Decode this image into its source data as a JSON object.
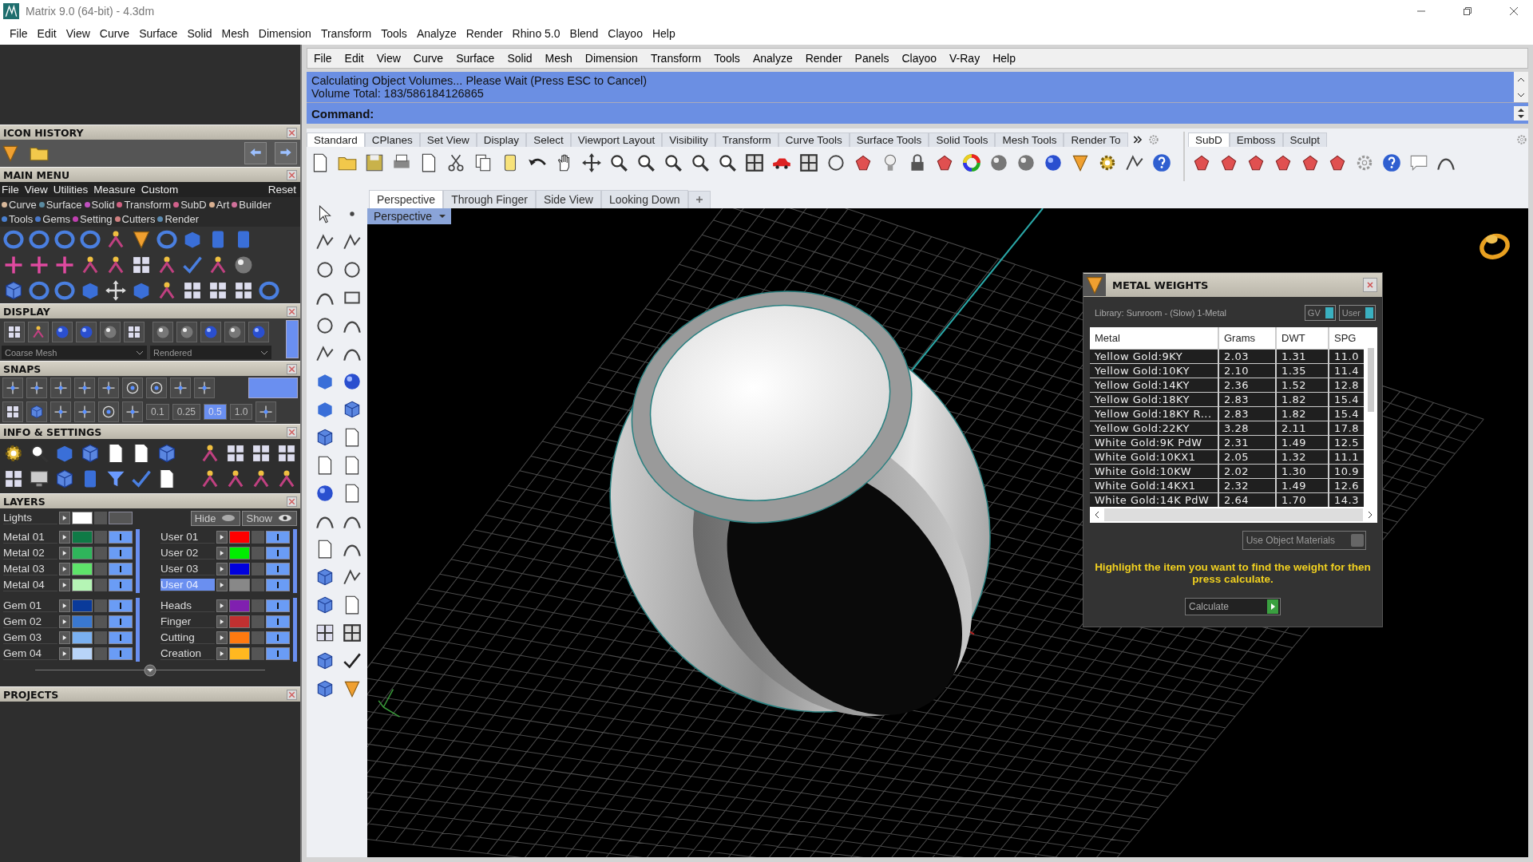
{
  "window": {
    "title": "Matrix 9.0 (64-bit) - 4.3dm"
  },
  "menu_bar": [
    "File",
    "Edit",
    "View",
    "Curve",
    "Surface",
    "Solid",
    "Mesh",
    "Dimension",
    "Transform",
    "Tools",
    "Analyze",
    "Render",
    "Rhino 5.0",
    "Blend",
    "Clayoo",
    "Help"
  ],
  "left_panel": {
    "icon_history": {
      "title": "ICON HISTORY"
    },
    "main_menu": {
      "title": "MAIN MENU",
      "menu": [
        "File",
        "View",
        "Utilities",
        "Measure",
        "Custom"
      ],
      "reset": "Reset",
      "categories": [
        {
          "label": "Curve",
          "color": "#d9b99b"
        },
        {
          "label": "Surface",
          "color": "#5a8aa0"
        },
        {
          "label": "Solid",
          "color": "#c050c0"
        },
        {
          "label": "Transform",
          "color": "#d06080"
        },
        {
          "label": "SubD",
          "color": "#d0608a"
        },
        {
          "label": "Art",
          "color": "#d9b090"
        },
        {
          "label": "Builder",
          "color": "#d0709a"
        },
        {
          "label": "Tools",
          "color": "#4a80d0"
        },
        {
          "label": "Gems",
          "color": "#4a78c8"
        },
        {
          "label": "Setting",
          "color": "#c040b0"
        },
        {
          "label": "Cutters",
          "color": "#d08080"
        },
        {
          "label": "Render",
          "color": "#5a8ab0"
        }
      ]
    },
    "display": {
      "title": "DISPLAY",
      "mesh": "Coarse Mesh",
      "mode": "Rendered",
      "panel_toggle_on": true
    },
    "snaps": {
      "title": "SNAPS",
      "panel_toggle_on": true,
      "values": [
        {
          "label": "0.1",
          "selected": false
        },
        {
          "label": "0.25",
          "selected": false
        },
        {
          "label": "0.5",
          "selected": true
        },
        {
          "label": "1.0",
          "selected": false
        }
      ]
    },
    "info": {
      "title": "INFO & SETTINGS"
    },
    "layers": {
      "title": "LAYERS",
      "lights": {
        "name": "Lights",
        "color": "#ffffff",
        "visible": false
      },
      "hide": "Hide",
      "show": "Show",
      "left": [
        [
          {
            "name": "Metal 01",
            "color": "#0f7a46",
            "selected": false,
            "visible": true
          },
          {
            "name": "Metal 02",
            "color": "#2fb55b",
            "selected": false,
            "visible": true
          },
          {
            "name": "Metal 03",
            "color": "#5ee36a",
            "selected": false,
            "visible": true
          },
          {
            "name": "Metal 04",
            "color": "#b5f5b5",
            "selected": false,
            "visible": true
          }
        ],
        [
          {
            "name": "Gem 01",
            "color": "#0a3a9a",
            "selected": false,
            "visible": true
          },
          {
            "name": "Gem 02",
            "color": "#3a78d0",
            "selected": false,
            "visible": true
          },
          {
            "name": "Gem 03",
            "color": "#7ab0f0",
            "selected": false,
            "visible": true
          },
          {
            "name": "Gem 04",
            "color": "#b8d4f8",
            "selected": false,
            "visible": true
          }
        ]
      ],
      "right": [
        [
          {
            "name": "User 01",
            "color": "#ff0000",
            "selected": false,
            "visible": true
          },
          {
            "name": "User 02",
            "color": "#00ee00",
            "selected": false,
            "visible": true
          },
          {
            "name": "User 03",
            "color": "#0000dd",
            "selected": false,
            "visible": true
          },
          {
            "name": "User 04",
            "color": "#888888",
            "selected": true,
            "visible": true
          }
        ],
        [
          {
            "name": "Heads",
            "color": "#8020b0",
            "selected": false,
            "visible": true
          },
          {
            "name": "Finger",
            "color": "#c03030",
            "selected": false,
            "visible": true
          },
          {
            "name": "Cutting",
            "color": "#ff7a10",
            "selected": false,
            "visible": true
          },
          {
            "name": "Creation",
            "color": "#ffb820",
            "selected": false,
            "visible": true
          }
        ]
      ]
    },
    "projects": {
      "title": "PROJECTS"
    }
  },
  "rhino": {
    "menu": [
      "File",
      "Edit",
      "View",
      "Curve",
      "Surface",
      "Solid",
      "Mesh",
      "Dimension",
      "Transform",
      "Tools",
      "Analyze",
      "Render",
      "Panels",
      "Clayoo",
      "V-Ray",
      "Help"
    ],
    "command_history": [
      "Calculating Object Volumes... Please Wait (Press ESC to Cancel)",
      "Volume Total: 183/586184126865"
    ],
    "command_label": "Command:",
    "toolbar_tabs": [
      {
        "label": "Standard",
        "selected": true
      },
      {
        "label": "CPlanes",
        "selected": false
      },
      {
        "label": "Set View",
        "selected": false
      },
      {
        "label": "Display",
        "selected": false
      },
      {
        "label": "Select",
        "selected": false
      },
      {
        "label": "Viewport Layout",
        "selected": false
      },
      {
        "label": "Visibility",
        "selected": false
      },
      {
        "label": "Transform",
        "selected": false
      },
      {
        "label": "Curve Tools",
        "selected": false
      },
      {
        "label": "Surface Tools",
        "selected": false
      },
      {
        "label": "Solid Tools",
        "selected": false
      },
      {
        "label": "Mesh Tools",
        "selected": false
      },
      {
        "label": "Render To",
        "selected": false
      }
    ],
    "side_tabs": [
      {
        "label": "SubD",
        "selected": true
      },
      {
        "label": "Emboss",
        "selected": false
      },
      {
        "label": "Sculpt",
        "selected": false
      }
    ],
    "viewport_tabs": [
      {
        "label": "Perspective",
        "selected": true
      },
      {
        "label": "Through Finger",
        "selected": false
      },
      {
        "label": "Side View",
        "selected": false
      },
      {
        "label": "Looking Down",
        "selected": false
      }
    ],
    "viewport_label": "Perspective"
  },
  "metal_weights": {
    "title": "METAL WEIGHTS",
    "library": "Library: Sunroom - (Slow) 1-Metal",
    "gv": "GV",
    "user": "User",
    "columns": [
      "Metal",
      "Grams",
      "DWT",
      "SPG"
    ],
    "rows": [
      [
        "Yellow Gold:9KY",
        "2.03",
        "1.31",
        "11.0"
      ],
      [
        "Yellow Gold:10KY",
        "2.10",
        "1.35",
        "11.4"
      ],
      [
        "Yellow Gold:14KY",
        "2.36",
        "1.52",
        "12.8"
      ],
      [
        "Yellow Gold:18KY",
        "2.83",
        "1.82",
        "15.4"
      ],
      [
        "Yellow Gold:18KY R...",
        "2.83",
        "1.82",
        "15.4"
      ],
      [
        "Yellow Gold:22KY",
        "3.28",
        "2.11",
        "17.8"
      ],
      [
        "White Gold:9K PdW",
        "2.31",
        "1.49",
        "12.5"
      ],
      [
        "White Gold:10KX1",
        "2.05",
        "1.32",
        "11.1"
      ],
      [
        "White Gold:10KW",
        "2.02",
        "1.30",
        "10.9"
      ],
      [
        "White Gold:14KX1",
        "2.32",
        "1.49",
        "12.6"
      ],
      [
        "White Gold:14K PdW",
        "2.64",
        "1.70",
        "14.3"
      ]
    ],
    "use_object_materials": "Use Object Materials",
    "hint": "Highlight the item you want to find the weight for then press calculate.",
    "calculate": "Calculate"
  }
}
